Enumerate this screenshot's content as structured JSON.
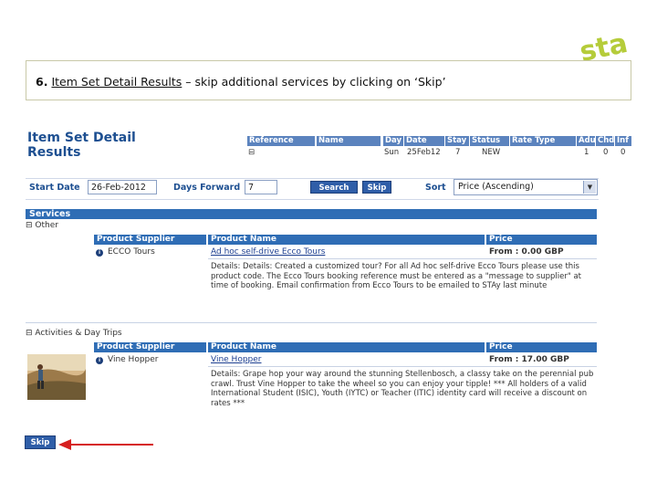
{
  "logo": {
    "text": "sta"
  },
  "instruction": {
    "step": "6.",
    "page_name": "Item Set Detail Results",
    "rest": " – skip additional services by clicking on ‘Skip’"
  },
  "page_title": "Item Set Detail Results",
  "reference_table": {
    "headers": [
      "Reference",
      "Name",
      "Day",
      "Date",
      "Stay",
      "Status",
      "Rate Type",
      "Adu",
      "Chd",
      "Inf"
    ],
    "row": {
      "expand": "⊟",
      "day": "Sun",
      "date": "25Feb12",
      "stay": "7",
      "status": "NEW",
      "adu": "1",
      "chd": "0",
      "inf": "0"
    }
  },
  "search": {
    "start_date_label": "Start Date",
    "start_date_value": "26-Feb-2012",
    "days_forward_label": "Days Forward",
    "days_forward_value": "7",
    "search_button": "Search",
    "skip_button": "Skip",
    "sort_label": "Sort",
    "sort_value": "Price (Ascending)"
  },
  "services": {
    "heading": "Services",
    "columns": {
      "supplier": "Product Supplier",
      "name": "Product Name",
      "price": "Price"
    },
    "groups": [
      {
        "title": "⊟ Other",
        "supplier": "ECCO Tours",
        "product": "Ad hoc self-drive Ecco Tours",
        "price": "From : 0.00 GBP",
        "description": "Details: Details: Created a customized tour? For all Ad hoc self-drive Ecco Tours please use this product code. The Ecco Tours booking reference must be entered as a \"message to supplier\" at time of booking. Email confirmation from Ecco Tours to be emailed to STAy last minute"
      },
      {
        "title": "⊟ Activities & Day Trips",
        "supplier": "Vine Hopper",
        "product": "Vine Hopper",
        "price": "From : 17.00 GBP",
        "description": "Details: Grape hop your way around the stunning Stellenbosch, a classy take on the perennial pub crawl. Trust Vine Hopper to take the wheel so you can enjoy your tipple! *** All holders of a valid International Student (ISIC), Youth (IYTC) or Teacher (ITIC) identity card will receive a discount on rates ***"
      }
    ]
  },
  "bottom": {
    "skip_button": "Skip"
  },
  "colors": {
    "header_blue": "#2f6db5",
    "title_blue": "#1d4f91",
    "arrow_red": "#d62020",
    "logo_green": "#b5cc3a"
  },
  "icons": {
    "info": "info-icon",
    "expand": "collapse-icon",
    "dropdown": "chevron-down-icon"
  }
}
